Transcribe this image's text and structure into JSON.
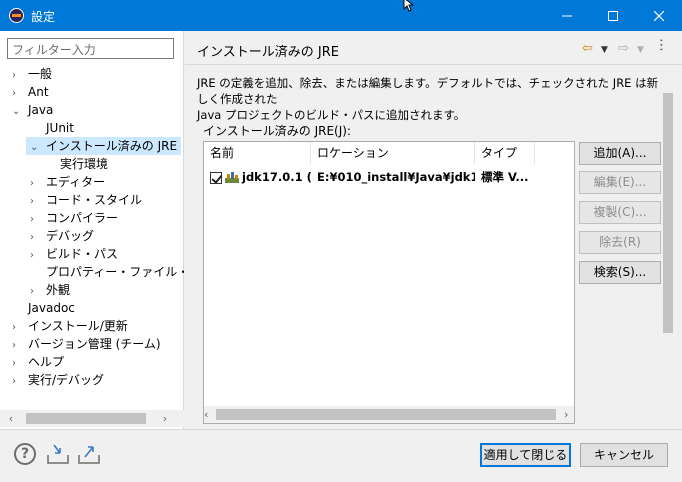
{
  "window": {
    "title": "設定"
  },
  "filter": {
    "placeholder": "フィルター入力"
  },
  "tree": [
    {
      "label": "一般",
      "level": 0,
      "expander": "›"
    },
    {
      "label": "Ant",
      "level": 0,
      "expander": "›"
    },
    {
      "label": "Java",
      "level": 0,
      "expander": "⌄"
    },
    {
      "label": "JUnit",
      "level": 1,
      "expander": ""
    },
    {
      "label": "インストール済みの JRE",
      "level": 1,
      "expander": "⌄",
      "selected": true
    },
    {
      "label": "実行環境",
      "level": 2,
      "expander": ""
    },
    {
      "label": "エディター",
      "level": 1,
      "expander": "›"
    },
    {
      "label": "コード・スタイル",
      "level": 1,
      "expander": "›"
    },
    {
      "label": "コンパイラー",
      "level": 1,
      "expander": "›"
    },
    {
      "label": "デバッグ",
      "level": 1,
      "expander": "›"
    },
    {
      "label": "ビルド・パス",
      "level": 1,
      "expander": "›"
    },
    {
      "label": "プロパティー・ファイル・エディタ",
      "level": 1,
      "expander": ""
    },
    {
      "label": "外観",
      "level": 1,
      "expander": "›"
    },
    {
      "label": "Javadoc",
      "level": 0,
      "expander": ""
    },
    {
      "label": "インストール/更新",
      "level": 0,
      "expander": "›"
    },
    {
      "label": "バージョン管理 (チーム)",
      "level": 0,
      "expander": "›"
    },
    {
      "label": "ヘルプ",
      "level": 0,
      "expander": "›"
    },
    {
      "label": "実行/デバッグ",
      "level": 0,
      "expander": "›"
    }
  ],
  "page": {
    "title": "インストール済みの JRE",
    "description_line1": "JRE の定義を追加、除去、または編集します。デフォルトでは、チェックされた JRE は新しく作成された",
    "description_line2": "Java プロジェクトのビルド・パスに追加されます。",
    "installed_label": "インストール済みの JRE(J):"
  },
  "table": {
    "columns": [
      "名前",
      "ロケーション",
      "タイプ"
    ],
    "rows": [
      {
        "name": "jdk17.0.1 (...",
        "location": "E:¥010_install¥Java¥jdk17....",
        "type": "標準 V...",
        "checked": true
      }
    ]
  },
  "buttons": {
    "add": "追加(A)...",
    "edit": "編集(E)...",
    "copy": "複製(C)...",
    "remove": "除去(R)",
    "search": "検索(S)..."
  },
  "footer": {
    "apply_close": "適用して閉じる",
    "cancel": "キャンセル"
  },
  "colors": {
    "titlebar": "#0078d7",
    "selection": "#cce8ff",
    "accent": "#0078d7"
  },
  "icons": [
    "eclipse-icon",
    "minimize-icon",
    "maximize-icon",
    "close-icon",
    "back-arrow-icon",
    "forward-arrow-icon",
    "view-menu-icon",
    "help-icon",
    "import-icon",
    "export-icon",
    "jre-library-icon"
  ]
}
